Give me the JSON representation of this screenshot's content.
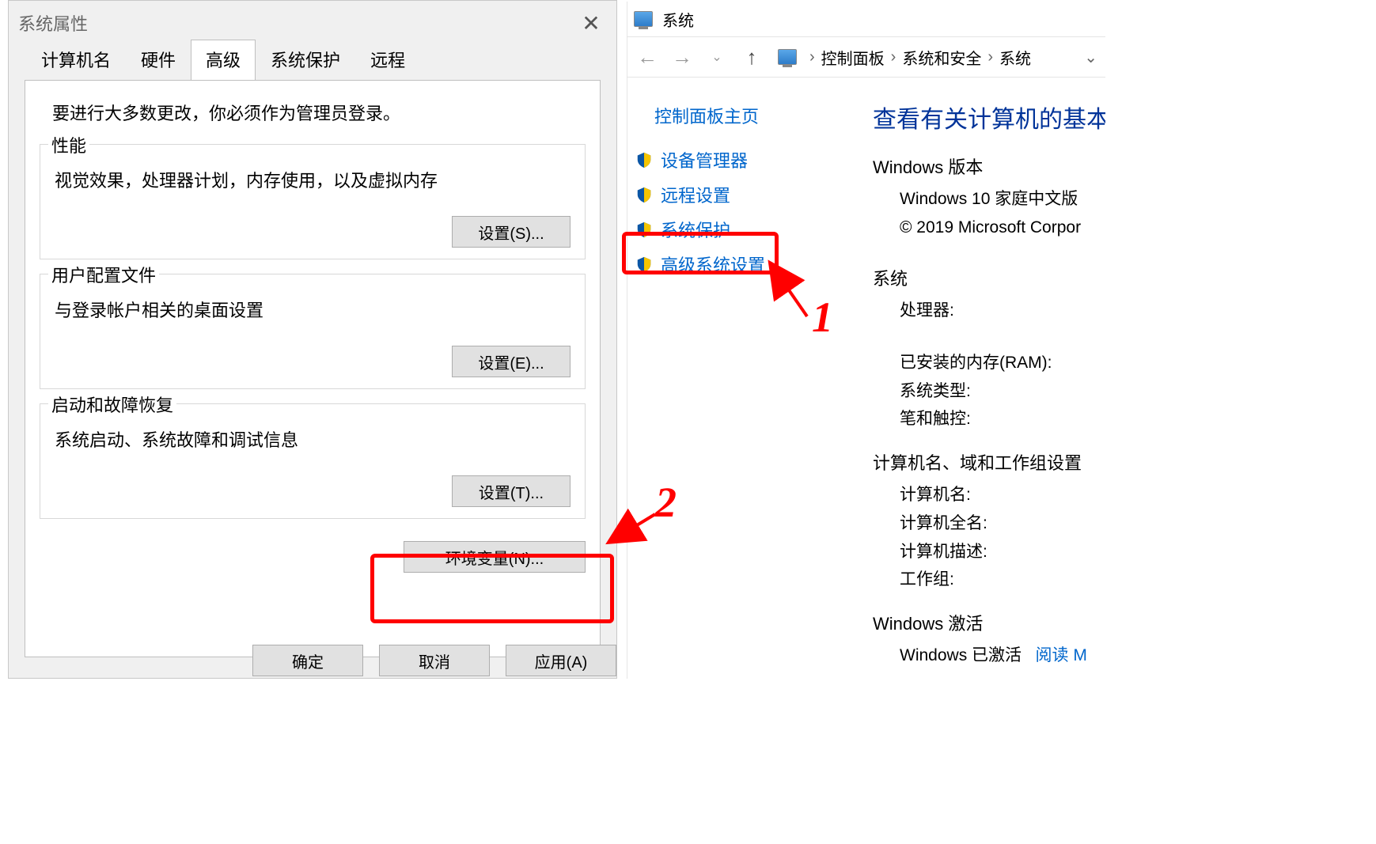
{
  "dialog": {
    "title": "系统属性",
    "tabs": {
      "computer_name": "计算机名",
      "hardware": "硬件",
      "advanced": "高级",
      "system_protection": "系统保护",
      "remote": "远程"
    },
    "intro": "要进行大多数更改，你必须作为管理员登录。",
    "groups": {
      "performance": {
        "legend": "性能",
        "desc": "视觉效果，处理器计划，内存使用，以及虚拟内存",
        "button": "设置(S)..."
      },
      "profiles": {
        "legend": "用户配置文件",
        "desc": "与登录帐户相关的桌面设置",
        "button": "设置(E)..."
      },
      "startup": {
        "legend": "启动和故障恢复",
        "desc": "系统启动、系统故障和调试信息",
        "button": "设置(T)..."
      }
    },
    "env_button": "环境变量(N)...",
    "ok": "确定",
    "cancel": "取消",
    "apply": "应用(A)"
  },
  "explorer": {
    "window_title": "系统",
    "breadcrumb": {
      "b1": "控制面板",
      "b2": "系统和安全",
      "b3": "系统"
    },
    "sidebar": {
      "home": "控制面板主页",
      "items": [
        {
          "label": "设备管理器"
        },
        {
          "label": "远程设置"
        },
        {
          "label": "系统保护"
        },
        {
          "label": "高级系统设置"
        }
      ]
    },
    "content": {
      "heading": "查看有关计算机的基本",
      "windows_edition_head": "Windows 版本",
      "windows_edition_line1": "Windows 10 家庭中文版",
      "windows_edition_line2": "© 2019 Microsoft Corpor",
      "system_head": "系统",
      "cpu_label": "处理器:",
      "ram_label": "已安装的内存(RAM):",
      "systype_label": "系统类型:",
      "pen_label": "笔和触控:",
      "compname_head": "计算机名、域和工作组设置",
      "compname_label": "计算机名:",
      "fullname_label": "计算机全名:",
      "compdesc_label": "计算机描述:",
      "workgroup_label": "工作组:",
      "activation_head": "Windows 激活",
      "activation_line": "Windows 已激活",
      "activation_link": "阅读 M"
    }
  },
  "annotations": {
    "one": "1",
    "two": "2"
  }
}
